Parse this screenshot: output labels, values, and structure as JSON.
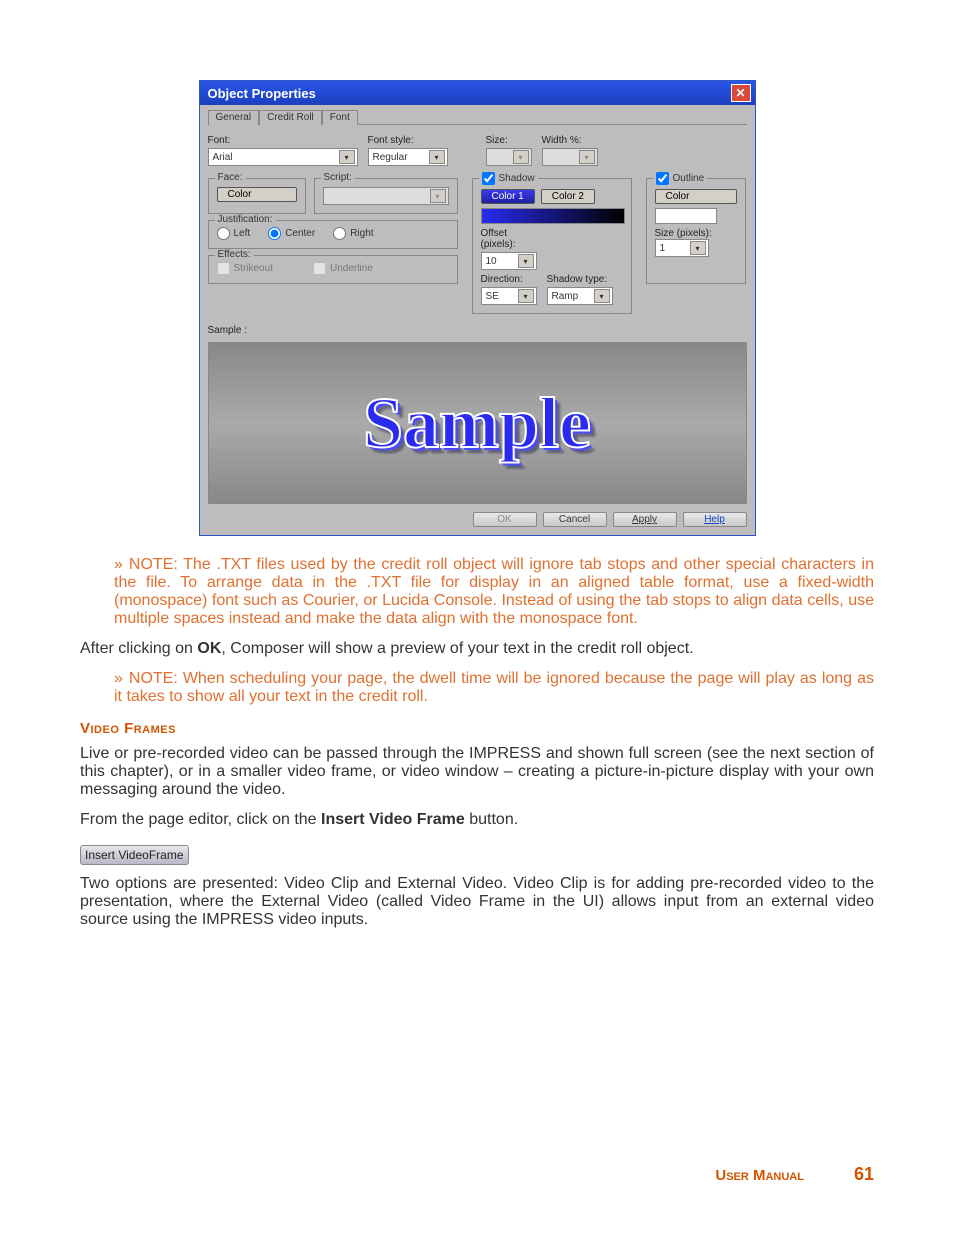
{
  "dialog": {
    "title": "Object Properties",
    "tabs": [
      "General",
      "Credit Roll",
      "Font"
    ],
    "active_tab": "Font",
    "font_label": "Font:",
    "font_value": "Arial",
    "fontstyle_label": "Font style:",
    "fontstyle_value": "Regular",
    "size_label": "Size:",
    "size_value": "",
    "width_label": "Width %:",
    "width_value": "",
    "face_legend": "Face:",
    "face_color_btn": "Color",
    "script_legend": "Script:",
    "script_value": "",
    "justification_legend": "Justification:",
    "just_left": "Left",
    "just_center": "Center",
    "just_right": "Right",
    "effects_legend": "Effects:",
    "eff_strikeout": "Strikeout",
    "eff_underline": "Underline",
    "shadow_legend": "Shadow",
    "shadow_color1": "Color 1",
    "shadow_color2": "Color 2",
    "offset_label": "Offset (pixels):",
    "offset_value": "10",
    "direction_label": "Direction:",
    "direction_value": "SE",
    "shadowtype_label": "Shadow type:",
    "shadowtype_value": "Ramp",
    "outline_legend": "Outline",
    "outline_color": "Color",
    "outline_size_label": "Size (pixels):",
    "outline_size_value": "1",
    "sample_label": "Sample :",
    "sample_text": "Sample",
    "buttons": {
      "ok": "OK",
      "cancel": "Cancel",
      "apply": "Apply",
      "help": "Help"
    }
  },
  "note1": "NOTE: The .TXT files used by the credit roll object will ignore tab stops and other special characters in the file. To arrange data in the .TXT file for display in an aligned table format, use a fixed-width (monospace) font such as Courier, or Lucida Console. Instead of using the tab stops to align data cells, use multiple spaces instead and make the data align with the monospace font.",
  "para1_a": "After clicking on ",
  "para1_b": "OK",
  "para1_c": ", Composer will show a preview of your text in the credit roll object.",
  "note2": "NOTE: When scheduling your page, the dwell time will be ignored because the page will play as long as it takes to show all your text in the credit roll.",
  "section_head": "Video Frames",
  "para2": "Live or pre-recorded video can be passed through the IMPRESS and shown full screen (see the next section of this chapter), or in a smaller video frame, or video window – creating a picture-in-picture display with your own messaging around the video.",
  "para3_a": "From the page editor, click on the ",
  "para3_b": "Insert Video Frame",
  "para3_c": " button.",
  "insert_btn": "Insert VideoFrame",
  "para4": "Two options are presented: Video Clip and External Video. Video Clip is for adding pre-recorded video to the presentation, where the External Video (called Video Frame in the UI) allows input from an external video source using the IMPRESS video inputs.",
  "footer": {
    "label": "User Manual",
    "page": "61"
  }
}
